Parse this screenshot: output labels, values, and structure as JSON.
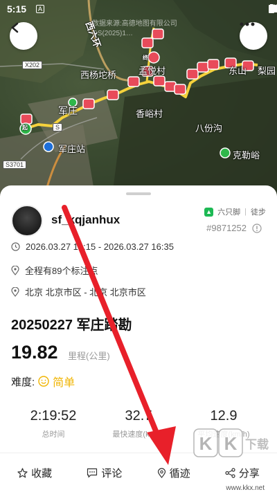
{
  "status_bar": {
    "time": "5:15",
    "indicator": "A"
  },
  "map": {
    "copyright_line1": "数据来源:高德地图有限公司",
    "copyright_line2": "GS(2025)1…",
    "labels": {
      "ring_road": "西六环",
      "xiyang": "西杨坨桥",
      "mengyue": "孟悦村",
      "xiangyu": "香峪村",
      "junzhuang": "军庄",
      "junzhuang_station": "军庄站",
      "bafengou": "八份沟",
      "kelei": "克勒峪",
      "dongshan": "东山",
      "liyuan": "梨园"
    },
    "road_badges": {
      "x202": "X202",
      "s3701": "S3701",
      "s": "S"
    },
    "markers": {
      "start": "起",
      "end": "终"
    }
  },
  "track": {
    "username": "sf_kqjanhux",
    "app_name": "六只脚",
    "activity_type": "徒步",
    "id": "#9871252",
    "time_range": "2026.03.27 14:15 - 2026.03.27 16:35",
    "waypoints": "全程有89个标注点",
    "location": "北京 北京市区 - 北京 北京市区",
    "title": "20250227 军庄踏勘",
    "distance": "19.82",
    "distance_label": "里程(公里)",
    "difficulty_label": "难度:",
    "difficulty_value": "简单"
  },
  "stats": [
    {
      "value": "2:19:52",
      "label": "总时间"
    },
    {
      "value": "32.7",
      "label": "最快速度(km/h)"
    },
    {
      "value": "12.9",
      "label": "平均速度(km/h)"
    }
  ],
  "actions": {
    "favorite": "收藏",
    "comment": "评论",
    "follow": "循迹",
    "share": "分享"
  },
  "watermark": {
    "brand": "KK下载",
    "url": "www.kkx.net"
  },
  "colors": {
    "accent": "#1db954",
    "track": "#f5d23c",
    "marker": "#e84b5a",
    "arrow": "#e8202a",
    "difficulty": "#f0b400"
  }
}
